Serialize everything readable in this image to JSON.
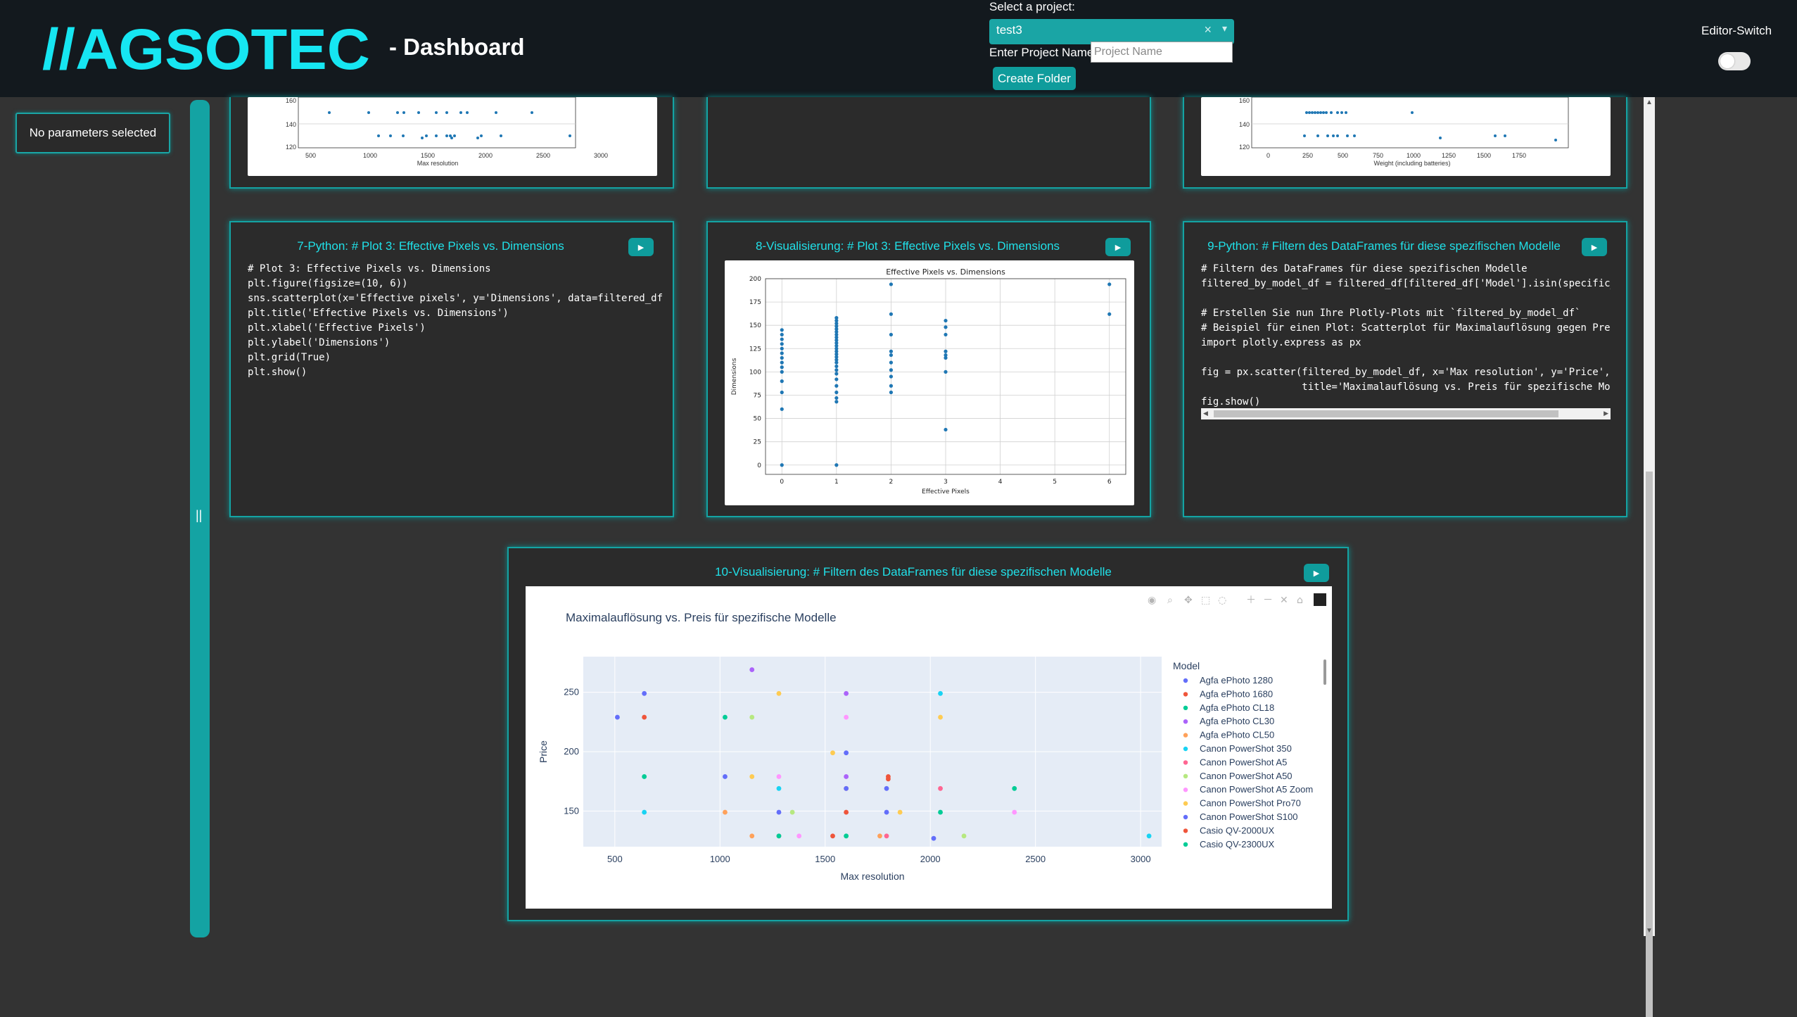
{
  "header": {
    "logo_text": "//AGSOTEC",
    "title": "- Dashboard",
    "project_label": "Select a project:",
    "project_value": "test3",
    "name_label": "Enter Project Name:",
    "name_placeholder": "Project Name",
    "create_button": "Create Folder",
    "editor_switch_label": "Editor-Switch"
  },
  "sidebar": {
    "params_text": "No parameters selected"
  },
  "colors": {
    "accent": "#14a3a3",
    "title_cyan": "#20e0e8",
    "background": "#333333",
    "header": "#13191e"
  },
  "top_partial": {
    "left_plot": {
      "y_ticks": [
        "160",
        "140",
        "120"
      ],
      "x_ticks": [
        "500",
        "1000",
        "1500",
        "2000",
        "2500",
        "3000"
      ],
      "xlabel": "Max resolution"
    },
    "right_plot": {
      "y_ticks": [
        "160",
        "140",
        "120"
      ],
      "x_ticks": [
        "0",
        "250",
        "500",
        "750",
        "1000",
        "1250",
        "1500",
        "1750"
      ],
      "xlabel": "Weight (including batteries)"
    }
  },
  "cells": {
    "c7": {
      "title": "7-Python: # Plot 3: Effective Pixels vs. Dimensions",
      "code": "# Plot 3: Effective Pixels vs. Dimensions\nplt.figure(figsize=(10, 6))\nsns.scatterplot(x='Effective pixels', y='Dimensions', data=filtered_df)\nplt.title('Effective Pixels vs. Dimensions')\nplt.xlabel('Effective Pixels')\nplt.ylabel('Dimensions')\nplt.grid(True)\nplt.show()"
    },
    "c8": {
      "title": "8-Visualisierung: # Plot 3: Effective Pixels vs. Dimensions"
    },
    "c9": {
      "title": "9-Python: # Filtern des DataFrames für diese spezifischen Modelle",
      "code": "# Filtern des DataFrames für diese spezifischen Modelle\nfiltered_by_model_df = filtered_df[filtered_df['Model'].isin(specific_models)]\n\n# Erstellen Sie nun Ihre Plotly-Plots mit `filtered_by_model_df`\n# Beispiel für einen Plot: Scatterplot für Maximalauflösung gegen Preis\nimport plotly.express as px\n\nfig = px.scatter(filtered_by_model_df, x='Max resolution', y='Price', color='Model',\n                 title='Maximalauflösung vs. Preis für spezifische Modelle')\nfig.show()"
    },
    "c10": {
      "title": "10-Visualisierung: # Filtern des DataFrames für diese spezifischen Modelle"
    }
  },
  "chart_data": [
    {
      "type": "scatter",
      "title": "Effective Pixels vs. Dimensions",
      "xlabel": "Effective Pixels",
      "ylabel": "Dimensions",
      "xlim": [
        -0.3,
        6.3
      ],
      "ylim": [
        -10,
        200
      ],
      "x_ticks": [
        0,
        1,
        2,
        3,
        4,
        5,
        6
      ],
      "y_ticks": [
        0,
        25,
        50,
        75,
        100,
        125,
        150,
        175,
        200
      ],
      "grid": true,
      "points": [
        [
          0,
          0
        ],
        [
          0,
          60
        ],
        [
          0,
          78
        ],
        [
          0,
          90
        ],
        [
          0,
          100
        ],
        [
          0,
          105
        ],
        [
          0,
          110
        ],
        [
          0,
          115
        ],
        [
          0,
          120
        ],
        [
          0,
          125
        ],
        [
          0,
          130
        ],
        [
          0,
          135
        ],
        [
          0,
          140
        ],
        [
          0,
          145
        ],
        [
          1,
          0
        ],
        [
          1,
          68
        ],
        [
          1,
          72
        ],
        [
          1,
          78
        ],
        [
          1,
          85
        ],
        [
          1,
          92
        ],
        [
          1,
          98
        ],
        [
          1,
          102
        ],
        [
          1,
          106
        ],
        [
          1,
          110
        ],
        [
          1,
          113
        ],
        [
          1,
          116
        ],
        [
          1,
          119
        ],
        [
          1,
          122
        ],
        [
          1,
          125
        ],
        [
          1,
          128
        ],
        [
          1,
          131
        ],
        [
          1,
          134
        ],
        [
          1,
          137
        ],
        [
          1,
          140
        ],
        [
          1,
          143
        ],
        [
          1,
          146
        ],
        [
          1,
          149
        ],
        [
          1,
          152
        ],
        [
          1,
          155
        ],
        [
          1,
          158
        ],
        [
          2,
          78
        ],
        [
          2,
          85
        ],
        [
          2,
          95
        ],
        [
          2,
          102
        ],
        [
          2,
          110
        ],
        [
          2,
          118
        ],
        [
          2,
          122
        ],
        [
          2,
          140
        ],
        [
          2,
          162
        ],
        [
          2,
          194
        ],
        [
          3,
          38
        ],
        [
          3,
          100
        ],
        [
          3,
          115
        ],
        [
          3,
          118
        ],
        [
          3,
          122
        ],
        [
          3,
          140
        ],
        [
          3,
          148
        ],
        [
          3,
          155
        ],
        [
          6,
          162
        ],
        [
          6,
          194
        ]
      ]
    },
    {
      "type": "scatter",
      "title": "Maximalauflösung vs. Preis für spezifische Modelle",
      "xlabel": "Max resolution",
      "ylabel": "Price",
      "xlim": [
        350,
        3100
      ],
      "ylim": [
        120,
        280
      ],
      "x_ticks": [
        500,
        1000,
        1500,
        2000,
        2500,
        3000
      ],
      "y_ticks": [
        150,
        200,
        250
      ],
      "legend_title": "Model",
      "legend_position": "right",
      "series": [
        {
          "name": "Agfa ePhoto 1280",
          "color": "#636efa",
          "points": [
            [
              512,
              229
            ],
            [
              640,
              249
            ],
            [
              1280,
              149
            ],
            [
              1600,
              199
            ],
            [
              1792,
              169
            ],
            [
              2016,
              127
            ]
          ]
        },
        {
          "name": "Agfa ePhoto 1680",
          "color": "#ef553b",
          "points": [
            [
              640,
              229
            ],
            [
              1600,
              149
            ],
            [
              1800,
              179
            ],
            [
              1536,
              129
            ]
          ]
        },
        {
          "name": "Agfa ePhoto CL18",
          "color": "#00cc96",
          "points": [
            [
              640,
              179
            ],
            [
              1024,
              229
            ],
            [
              2400,
              169
            ],
            [
              2048,
              149
            ]
          ]
        },
        {
          "name": "Agfa ePhoto CL30",
          "color": "#ab63fa",
          "points": [
            [
              1152,
              269
            ],
            [
              1600,
              249
            ],
            [
              1600,
              179
            ]
          ]
        },
        {
          "name": "Agfa ePhoto CL50",
          "color": "#ffa15a",
          "points": [
            [
              1024,
              149
            ],
            [
              1152,
              129
            ],
            [
              1600,
              169
            ],
            [
              1760,
              129
            ]
          ]
        },
        {
          "name": "Canon PowerShot 350",
          "color": "#19d3f3",
          "points": [
            [
              640,
              149
            ],
            [
              1280,
              169
            ],
            [
              2048,
              249
            ],
            [
              3040,
              129
            ]
          ]
        },
        {
          "name": "Canon PowerShot A5",
          "color": "#ff6692",
          "points": [
            [
              1280,
              129
            ],
            [
              1792,
              129
            ],
            [
              2048,
              169
            ]
          ]
        },
        {
          "name": "Canon PowerShot A50",
          "color": "#b6e880",
          "points": [
            [
              1152,
              229
            ],
            [
              1344,
              149
            ],
            [
              2160,
              129
            ],
            [
              1600,
              129
            ]
          ]
        },
        {
          "name": "Canon PowerShot A5 Zoom",
          "color": "#ff97ff",
          "points": [
            [
              1280,
              179
            ],
            [
              1600,
              229
            ],
            [
              2400,
              149
            ],
            [
              1376,
              129
            ]
          ]
        },
        {
          "name": "Canon PowerShot Pro70",
          "color": "#fecb52",
          "points": [
            [
              1152,
              179
            ],
            [
              1280,
              249
            ],
            [
              1536,
              199
            ],
            [
              1856,
              149
            ],
            [
              2048,
              229
            ]
          ]
        },
        {
          "name": "Canon PowerShot S100",
          "color": "#636efa",
          "points": [
            [
              1024,
              179
            ],
            [
              1792,
              149
            ],
            [
              1600,
              169
            ]
          ]
        },
        {
          "name": "Casio QV-2000UX",
          "color": "#ef553b",
          "points": [
            [
              1800,
              177
            ]
          ]
        },
        {
          "name": "Casio QV-2300UX",
          "color": "#00cc96",
          "points": [
            [
              1280,
              129
            ],
            [
              1600,
              129
            ]
          ]
        }
      ]
    }
  ]
}
